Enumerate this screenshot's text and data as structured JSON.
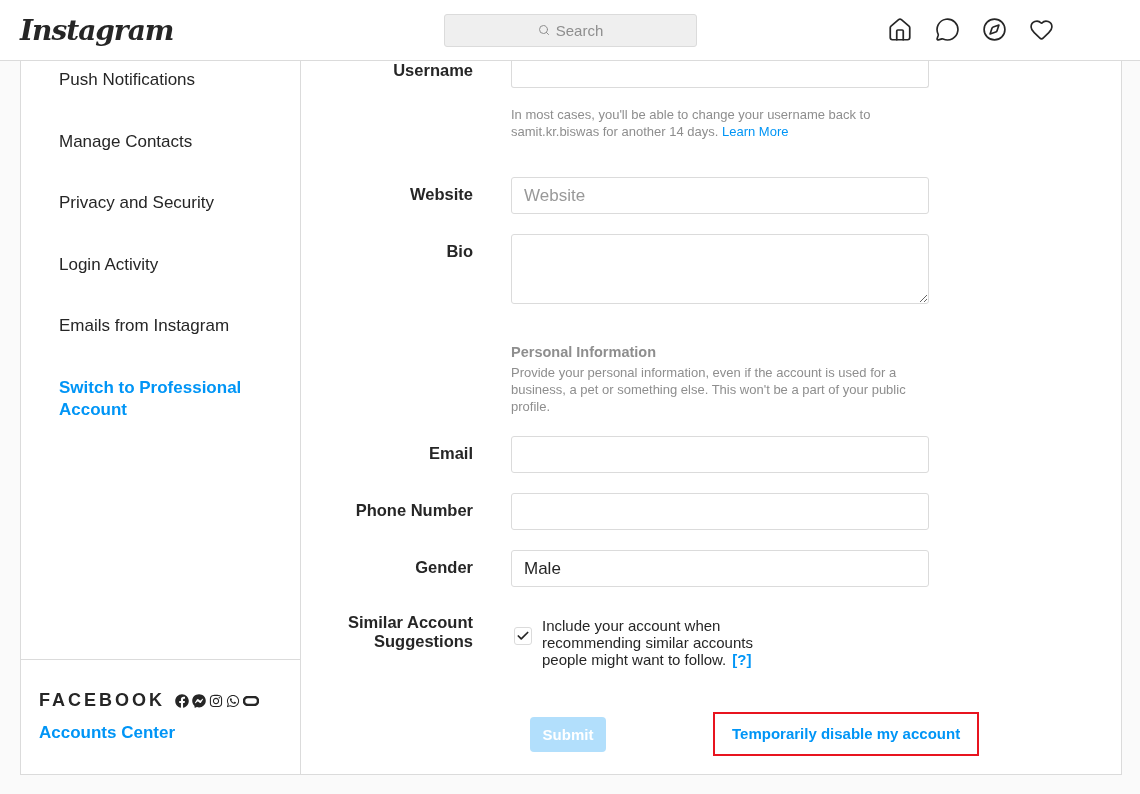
{
  "header": {
    "logo": "Instagram",
    "search": {
      "placeholder": "Search"
    }
  },
  "sidebar": {
    "items": [
      {
        "label": "Push Notifications",
        "kind": "plain"
      },
      {
        "label": "Manage Contacts",
        "kind": "plain"
      },
      {
        "label": "Privacy and Security",
        "kind": "plain"
      },
      {
        "label": "Login Activity",
        "kind": "plain"
      },
      {
        "label": "Emails from Instagram",
        "kind": "plain"
      },
      {
        "label": "Switch to Professional Account",
        "kind": "promo"
      }
    ],
    "footer": {
      "brand": "FACEBOOK",
      "link": "Accounts Center"
    }
  },
  "form": {
    "username": {
      "label": "Username",
      "hint": "In most cases, you'll be able to change your username back to samit.kr.biswas for another 14 days.",
      "hint_link": "Learn More"
    },
    "fields": [
      {
        "label": "Website",
        "placeholder": "Website",
        "kind": "input"
      },
      {
        "label": "Bio",
        "kind": "textarea"
      }
    ],
    "personal": {
      "title": "Personal Information",
      "description": "Provide your personal information, even if the account is used for a business, a pet or something else. This won't be a part of your public profile."
    },
    "personal_fields": [
      {
        "label": "Email"
      },
      {
        "label": "Phone Number"
      },
      {
        "label": "Gender",
        "value": "Male"
      }
    ],
    "suggestions": {
      "label": "Similar Account Suggestions",
      "text": "Include your account when recommending similar accounts people might want to follow.",
      "help": "[?]",
      "checked": true
    },
    "submit": {
      "label": "Submit",
      "disabled": true
    },
    "disable_link": {
      "label": "Temporarily disable my account",
      "highlighted": true
    }
  }
}
